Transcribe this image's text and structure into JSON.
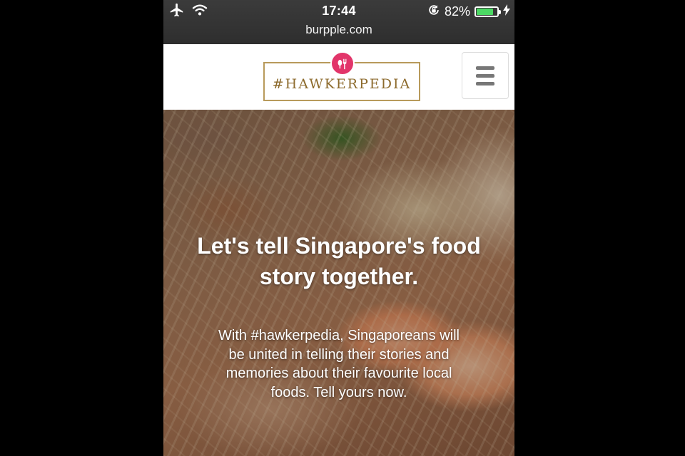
{
  "status_bar": {
    "time": "17:44",
    "battery_percent": "82%",
    "battery_level": 0.82,
    "icons": [
      "airplane-icon",
      "wifi-icon",
      "rotation-lock-icon",
      "battery-icon",
      "charging-bolt-icon"
    ]
  },
  "browser": {
    "url": "burpple.com"
  },
  "header": {
    "logo_text": "#HAWKERPEDIA",
    "menu_icon": "hamburger-menu-icon"
  },
  "hero": {
    "title": "Let's tell Singapore's food story together.",
    "body": "With #hawkerpedia, Singaporeans will be united in telling their stories and memories about their favourite local foods. Tell yours now."
  },
  "colors": {
    "logo_border": "#b89a5b",
    "logo_text": "#8c6a2c",
    "logo_badge": "#e2356a",
    "battery_fill": "#4cd964",
    "chrome_background": "#333333"
  }
}
